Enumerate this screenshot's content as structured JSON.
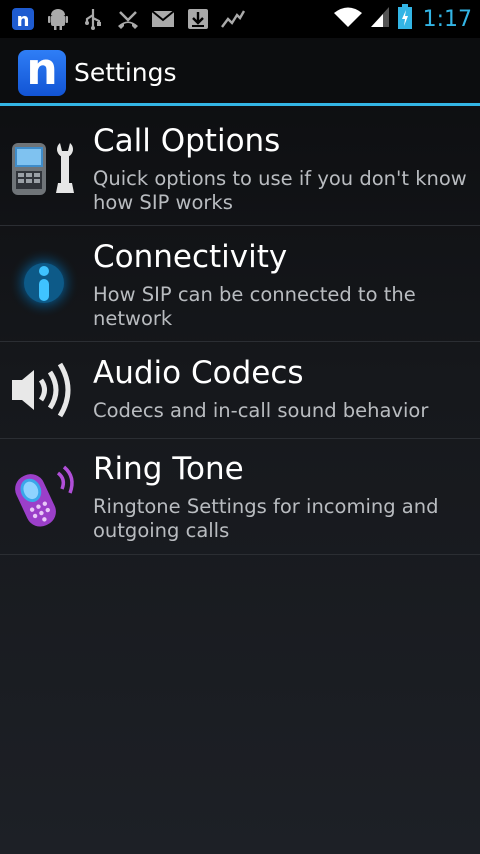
{
  "status_bar": {
    "time": "1:17",
    "icons": [
      "app-n-icon",
      "android-icon",
      "usb-icon",
      "missed-call-icon",
      "gmail-icon",
      "download-icon",
      "stocks-icon",
      "wifi-icon",
      "signal-icon",
      "battery-icon"
    ],
    "accent": "#33b5e5"
  },
  "action_bar": {
    "logo_letter": "n",
    "title": "Settings"
  },
  "settings_list": [
    {
      "title": "Call Options",
      "subtitle": "Quick options to use if you don't know how SIP works",
      "icon": "phone-wrench-icon"
    },
    {
      "title": "Connectivity",
      "subtitle": "How SIP can be connected to the network",
      "icon": "info-glow-icon"
    },
    {
      "title": "Audio Codecs",
      "subtitle": "Codecs and in-call sound behavior",
      "icon": "speaker-icon"
    },
    {
      "title": "Ring Tone",
      "subtitle": "Ringtone Settings for incoming and outgoing calls",
      "icon": "ringing-phone-icon"
    }
  ]
}
